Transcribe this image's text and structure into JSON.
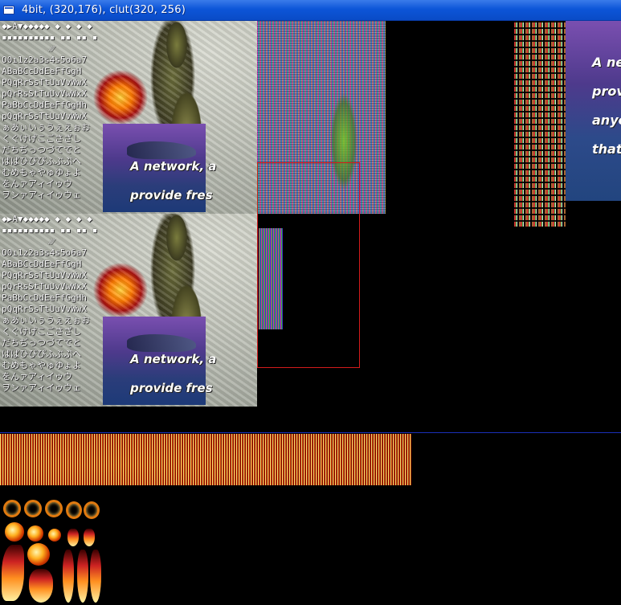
{
  "window": {
    "title": "4bit, (320,176), clut(320, 256)"
  },
  "font_sheet": {
    "glyph_rows": [
      "◆▶A▼◆◆◆◆◆ ◆ ◆ ◆ ◆",
      "▪▪▪▪▪▪▪▪▪▪ ▪▪ ▪▪ ▪",
      "         ⁄⁄⁄  ",
      "O0ı1z2a3s4s5o6a7",
      "ABaBCcDdEeFfGgH",
      "PQqRrSsTtUuVvWwX",
      "pQrRsStTuUvVwWxX",
      "PaBbCcDdEeFfGgHh",
      "pQqRrSsTtUuVvWwX",
      "ぁあぃいぅうぇえぉお",
      "くぐけげこごさざし",
      "だちぢっつづてでと",
      "ばぱひびぴふぶぷへ",
      "むめもゃやゅゆょよ",
      "をんァアィイゥウ",
      "ヲンァアィイゥウェ"
    ],
    "banner_lines": [
      "A network, a",
      "provide fres"
    ]
  },
  "banner_large": {
    "lines": [
      "A ne",
      "prov",
      "anyo",
      "that"
    ]
  }
}
